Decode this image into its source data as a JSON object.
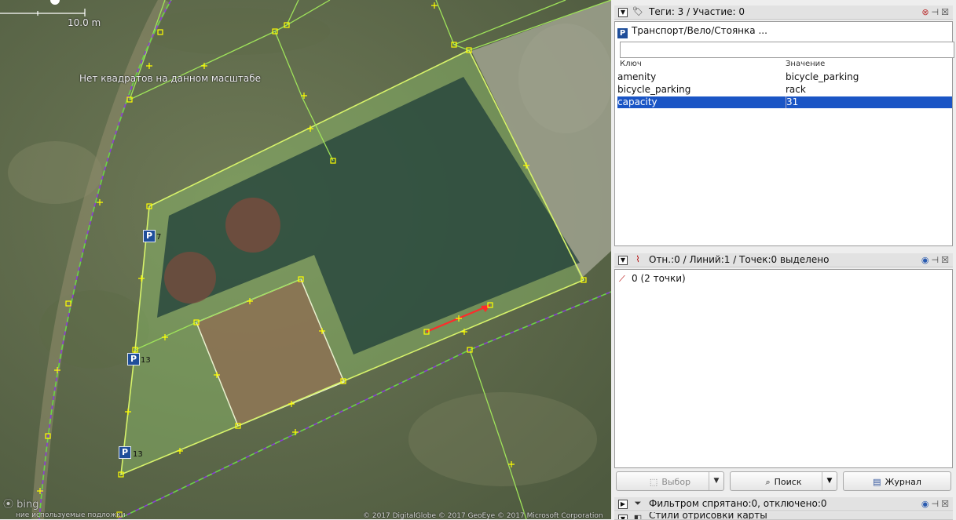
{
  "map": {
    "scale_label": "10.0 m",
    "no_imagery_text": "Нет квадратов на данном масштабе",
    "bing_label": "bing",
    "attribution": "© 2017 DigitalGlobe © 2017 GeoEye © 2017 Microsoft Corporation",
    "bottom_left_text": "ние используемые подложки",
    "parking_badges": [
      {
        "label": "P",
        "count": "7"
      },
      {
        "label": "P",
        "count": "13"
      },
      {
        "label": "P",
        "count": "13"
      }
    ],
    "colors": {
      "way": "#9fe35a",
      "selected_way": "#ff2a2a",
      "node": "#ffff00",
      "track": "#8a3fd6"
    }
  },
  "tags_panel": {
    "title": "Теги: 3 / Участие: 0",
    "icon": "tags-icon",
    "preset_label": "Транспорт/Вело/Стоянка ...",
    "preset_icon": "P",
    "filter_placeholder": "",
    "columns": {
      "key": "Ключ",
      "value": "Значение"
    },
    "rows": [
      {
        "key": "amenity",
        "value": "bicycle_parking"
      },
      {
        "key": "bicycle_parking",
        "value": "rack"
      },
      {
        "key": "capacity",
        "value": "31",
        "selected": true
      }
    ]
  },
  "selection_panel": {
    "title": "Отн.:0 / Линий:1 / Точек:0 выделено",
    "items": [
      {
        "label": "0 (2 точки)",
        "icon": "way-icon"
      }
    ]
  },
  "buttons": {
    "select": "Выбор",
    "search": "Поиск",
    "history": "Журнал"
  },
  "filter_panel": {
    "title": "Фильтром спрятано:0, отключено:0"
  },
  "styles_panel": {
    "title": "Стили отрисовки карты"
  }
}
